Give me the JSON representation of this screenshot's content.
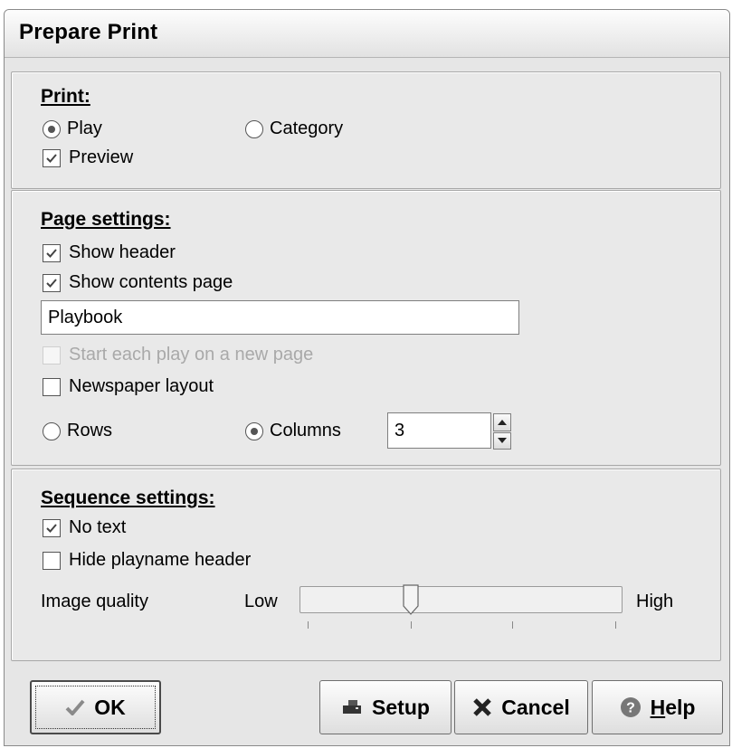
{
  "window": {
    "title": "Prepare Print"
  },
  "print_group": {
    "heading": "Print:",
    "play_label": "Play",
    "category_label": "Category",
    "preview_label": "Preview",
    "selected": "Play",
    "preview_checked": true
  },
  "page_settings": {
    "heading": "Page settings:",
    "show_header_label": "Show header",
    "show_header_checked": true,
    "show_contents_label": "Show contents page",
    "show_contents_checked": true,
    "title_value": "Playbook",
    "start_each_play_label": "Start each play on a new page",
    "start_each_play_enabled": false,
    "newspaper_label": "Newspaper layout",
    "newspaper_checked": false,
    "rows_label": "Rows",
    "columns_label": "Columns",
    "layout_selected": "Columns",
    "count_value": "3"
  },
  "sequence_settings": {
    "heading": "Sequence settings:",
    "no_text_label": "No text",
    "no_text_checked": true,
    "hide_playname_label": "Hide playname header",
    "hide_playname_checked": false,
    "image_quality_label": "Image quality",
    "low_label": "Low",
    "high_label": "High",
    "image_quality_level": 0.33
  },
  "buttons": {
    "ok": "OK",
    "setup": "Setup",
    "cancel": "Cancel",
    "help": "Help"
  },
  "icons": {
    "ok": "check-icon",
    "setup": "printer-icon",
    "cancel": "x-icon",
    "help": "question-icon"
  }
}
